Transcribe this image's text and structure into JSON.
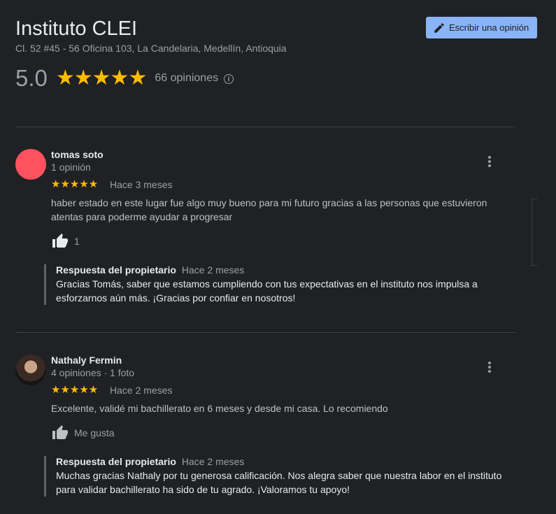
{
  "business": {
    "name": "Instituto CLEI",
    "address": "Cl. 52 #45 - 56 Oficina 103, La Candelaria, Medellín, Antioquia",
    "rating": "5.0",
    "stars": "★★★★★",
    "review_count": "66 opiniones"
  },
  "write_button": {
    "label": "Escribir una opinión",
    "icon": "pencil-icon"
  },
  "reviews": [
    {
      "author": "tomas soto",
      "meta": "1 opinión",
      "stars": "★★★★★",
      "rating": 5,
      "date": "Hace 3 meses",
      "text": "haber estado en este lugar fue algo muy bueno para mi futuro gracias a las personas que estuvieron atentas para poderme ayudar a progresar",
      "likes": "1",
      "avatar_color": "#ff5160",
      "owner_response": {
        "title": "Respuesta del propietario",
        "date": "Hace 2 meses",
        "text": "Gracias Tomás, saber que estamos cumpliendo con tus expectativas en el instituto nos impulsa a esforzarnos aún más. ¡Gracias por confiar en nosotros!"
      }
    },
    {
      "author": "Nathaly Fermin",
      "meta": "4 opiniones · 1 foto",
      "stars": "★★★★★",
      "rating": 5,
      "date": "Hace 2 meses",
      "text": "Excelente, validé mi bachillerato en 6 meses y desde mi casa. Lo recomiendo",
      "likes": "Me gusta",
      "owner_response": {
        "title": "Respuesta del propietario",
        "date": "Hace 2 meses",
        "text": "Muchas gracias Nathaly por tu generosa calificación. Nos alegra saber que nuestra labor en el instituto para validar bachillerato ha sido de tu agrado. ¡Valoramos tu apoyo!"
      }
    }
  ],
  "colors": {
    "star": "#fbbc04",
    "accent_button": "#8ab4f8",
    "background": "#202124"
  }
}
